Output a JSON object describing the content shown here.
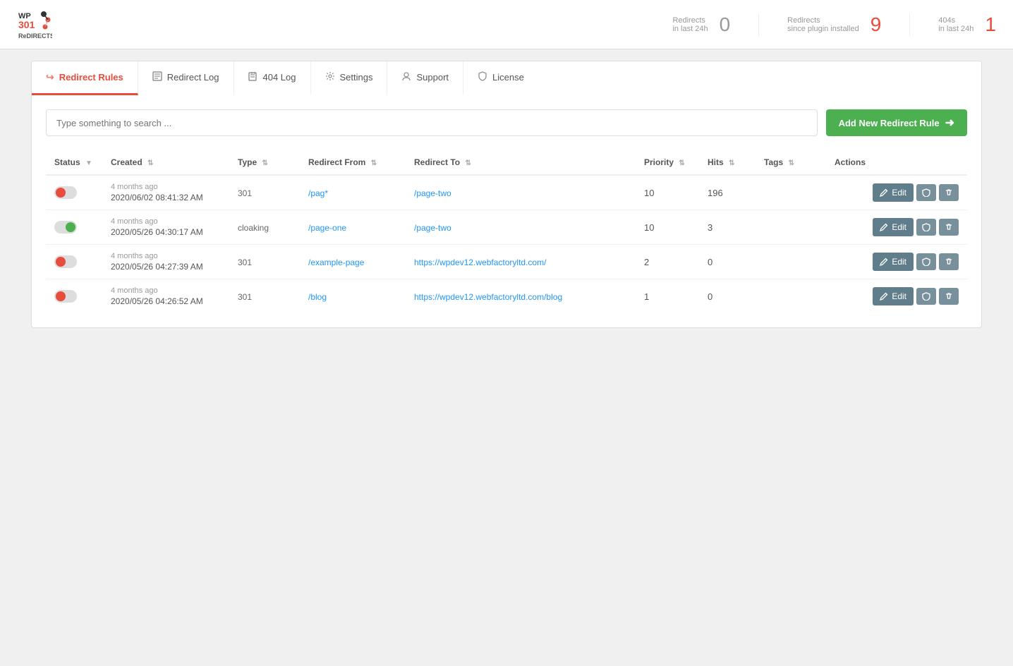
{
  "header": {
    "logo_line1": "WP",
    "logo_line2": "301",
    "logo_line3": "ReDIRECTS",
    "stats": [
      {
        "label": "Redirects",
        "sublabel": "in last 24h",
        "value": "0",
        "zero": true
      },
      {
        "label": "Redirects",
        "sublabel": "since plugin installed",
        "value": "9",
        "zero": false
      },
      {
        "label": "404s",
        "sublabel": "in last 24h",
        "value": "1",
        "zero": false
      }
    ]
  },
  "tabs": [
    {
      "label": "Redirect Rules",
      "icon": "↪",
      "active": true
    },
    {
      "label": "Redirect Log",
      "icon": "📋",
      "active": false
    },
    {
      "label": "404 Log",
      "icon": "📄",
      "active": false
    },
    {
      "label": "Settings",
      "icon": "⚙",
      "active": false
    },
    {
      "label": "Support",
      "icon": "👤",
      "active": false
    },
    {
      "label": "License",
      "icon": "🛡",
      "active": false
    }
  ],
  "toolbar": {
    "search_placeholder": "Type something to search ...",
    "add_button_label": "Add New Redirect Rule"
  },
  "table": {
    "columns": [
      {
        "key": "status",
        "label": "Status",
        "sortable": true
      },
      {
        "key": "created",
        "label": "Created",
        "sortable": true
      },
      {
        "key": "type",
        "label": "Type",
        "sortable": true
      },
      {
        "key": "redirect_from",
        "label": "Redirect From",
        "sortable": true
      },
      {
        "key": "redirect_to",
        "label": "Redirect To",
        "sortable": true
      },
      {
        "key": "priority",
        "label": "Priority",
        "sortable": true
      },
      {
        "key": "hits",
        "label": "Hits",
        "sortable": true
      },
      {
        "key": "tags",
        "label": "Tags",
        "sortable": true
      },
      {
        "key": "actions",
        "label": "Actions",
        "sortable": false
      }
    ],
    "rows": [
      {
        "status": "inactive",
        "date_ago": "4 months ago",
        "date_main": "2020/06/02 08:41:32 AM",
        "type": "301",
        "redirect_from": "/pag*",
        "redirect_to": "/page-two",
        "priority": "10",
        "hits": "196",
        "tags": ""
      },
      {
        "status": "active",
        "date_ago": "4 months ago",
        "date_main": "2020/05/26 04:30:17 AM",
        "type": "cloaking",
        "redirect_from": "/page-one",
        "redirect_to": "/page-two",
        "priority": "10",
        "hits": "3",
        "tags": ""
      },
      {
        "status": "inactive",
        "date_ago": "4 months ago",
        "date_main": "2020/05/26 04:27:39 AM",
        "type": "301",
        "redirect_from": "/example-page",
        "redirect_to": "https://wpdev12.webfactoryltd.com/",
        "priority": "2",
        "hits": "0",
        "tags": ""
      },
      {
        "status": "inactive",
        "date_ago": "4 months ago",
        "date_main": "2020/05/26 04:26:52 AM",
        "type": "301",
        "redirect_from": "/blog",
        "redirect_to": "https://wpdev12.webfactoryltd.com/blog",
        "priority": "1",
        "hits": "0",
        "tags": ""
      }
    ]
  },
  "actions": {
    "edit_label": "Edit",
    "shield_icon": "🛡",
    "delete_icon": "🗑"
  }
}
